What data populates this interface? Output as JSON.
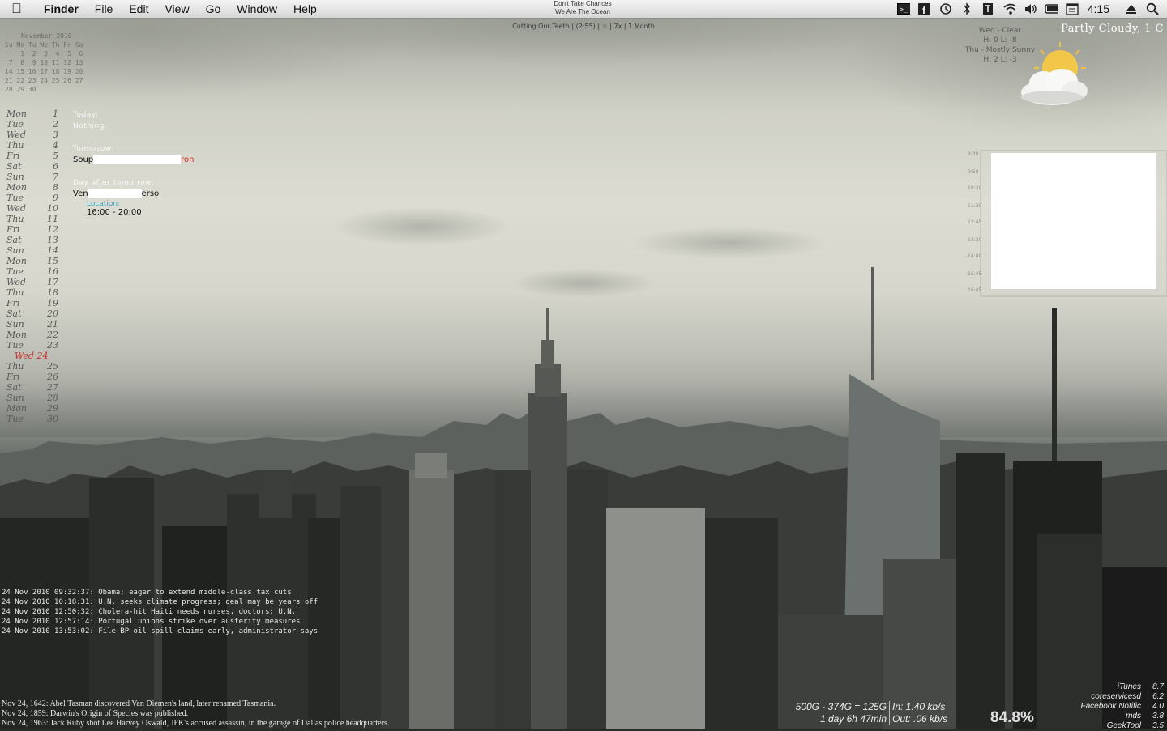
{
  "menubar": {
    "app_name": "Finder",
    "menus": [
      "File",
      "Edit",
      "View",
      "Go",
      "Window",
      "Help"
    ],
    "now_playing": {
      "line1": "Don't Take Chances",
      "line2": "We Are The Ocean"
    },
    "clock": "4:15",
    "status_icons": [
      "terminal-icon",
      "facebook-icon",
      "time-machine-icon",
      "bluetooth-icon",
      "evernote-icon",
      "wifi-icon",
      "volume-icon",
      "battery-icon",
      "calendar-icon",
      "eject-icon",
      "spotlight-icon"
    ]
  },
  "track_info": "Cutting Our Teeth | (2:55) | ☆ | 7x | 1 Month",
  "mini_calendar": {
    "title": "November 2010",
    "rows": [
      "Su Mo Tu We Th Fr Sa",
      "    1  2  3  4  5  6",
      " 7  8  9 10 11 12 13",
      "14 15 16 17 18 19 20",
      "21 22 23 24 25 26 27",
      "28 29 30"
    ]
  },
  "day_list": [
    {
      "name": "Mon",
      "day": "1"
    },
    {
      "name": "Tue",
      "day": "2"
    },
    {
      "name": "Wed",
      "day": "3"
    },
    {
      "name": "Thu",
      "day": "4"
    },
    {
      "name": "Fri",
      "day": "5"
    },
    {
      "name": "Sat",
      "day": "6"
    },
    {
      "name": "Sun",
      "day": "7"
    },
    {
      "name": "Mon",
      "day": "8"
    },
    {
      "name": "Tue",
      "day": "9"
    },
    {
      "name": "Wed",
      "day": "10"
    },
    {
      "name": "Thu",
      "day": "11"
    },
    {
      "name": "Fri",
      "day": "12"
    },
    {
      "name": "Sat",
      "day": "13"
    },
    {
      "name": "Sun",
      "day": "14"
    },
    {
      "name": "Mon",
      "day": "15"
    },
    {
      "name": "Tue",
      "day": "16"
    },
    {
      "name": "Wed",
      "day": "17"
    },
    {
      "name": "Thu",
      "day": "18"
    },
    {
      "name": "Fri",
      "day": "19"
    },
    {
      "name": "Sat",
      "day": "20"
    },
    {
      "name": "Sun",
      "day": "21"
    },
    {
      "name": "Mon",
      "day": "22"
    },
    {
      "name": "Tue",
      "day": "23"
    },
    {
      "name": "Wed 24",
      "day": "",
      "today": true
    },
    {
      "name": "Thu",
      "day": "25"
    },
    {
      "name": "Fri",
      "day": "26"
    },
    {
      "name": "Sat",
      "day": "27"
    },
    {
      "name": "Sun",
      "day": "28"
    },
    {
      "name": "Mon",
      "day": "29"
    },
    {
      "name": "Tue",
      "day": "30"
    }
  ],
  "agenda": {
    "today_label": "Today:",
    "today_event": "Nothing.",
    "tomorrow_label": "Tomorrow:",
    "tomorrow_event_start": "Soup",
    "tomorrow_event_end": "ron",
    "dayafter_label": "Day after tomorrow:",
    "dayafter_event_start": "Ven",
    "dayafter_event_end": "erso",
    "location_label": "Location:",
    "time": "16:00 - 20:00"
  },
  "weather": {
    "condition": "Partly Cloudy, 1 C",
    "forecast": [
      "Wed - Clear",
      "H: 0  L: -8",
      "Thu - Mostly Sunny",
      "H: 2  L: -3"
    ]
  },
  "news": [
    "24 Nov 2010 09:32:37: Obama: eager to extend middle-class tax cuts",
    "24 Nov 2010 10:18:31: U.N. seeks climate progress; deal may be years off",
    "24 Nov 2010 12:50:32: Cholera-hit Haiti needs nurses, doctors: U.N.",
    "24 Nov 2010 12:57:14: Portugal unions strike over austerity measures",
    "24 Nov 2010 13:53:02: File BP oil spill claims early, administrator says"
  ],
  "history": [
    "Nov 24, 1642: Abel Tasman discovered Van Diemen's land, later renamed Tasmania.",
    "Nov 24, 1859: Darwin's Origin of Species was published.",
    "Nov 24, 1963: Jack Ruby shot Lee Harvey Oswald, JFK's accused assassin, in the garage of Dallas police headquarters."
  ],
  "system": {
    "disk": "500G - 374G = 125G",
    "uptime": "1 day 6h 47min",
    "net_in": "In: 1.40 kb/s",
    "net_out": "Out: .06 kb/s",
    "cpu": "84.8%",
    "processes": [
      {
        "name": "iTunes",
        "value": "8.7"
      },
      {
        "name": "coreservicesd",
        "value": "6.2"
      },
      {
        "name": "Facebook Notific",
        "value": "4.0"
      },
      {
        "name": "mds",
        "value": "3.8"
      },
      {
        "name": "GeekTool",
        "value": "3.5"
      }
    ]
  }
}
